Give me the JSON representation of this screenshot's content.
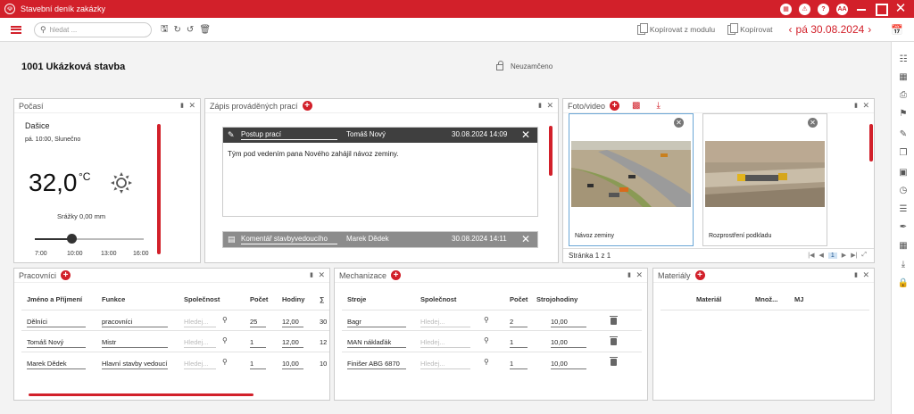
{
  "app": {
    "title": "Stavební deník zakázky",
    "logo_letter": "☫",
    "user_initials": "AA",
    "help_glyph": "?"
  },
  "toolbar": {
    "search_placeholder": "hledat ...",
    "copy_module_label": "Kopírovat z modulu",
    "copy_label": "Kopírovat",
    "date_label": "pá 30.08.2024"
  },
  "project": {
    "title": "1001  Ukázková stavba",
    "lock_status": "Neuzamčeno"
  },
  "weather": {
    "header": "Počasí",
    "location": "Dašice",
    "subtitle": "pá. 10:00, Slunečno",
    "temperature": "32,0",
    "unit": "°C",
    "rain": "Srážky 0,00 mm",
    "slider_value": 0.34,
    "ticks": [
      "7:00",
      "10:00",
      "13:00",
      "16:00"
    ]
  },
  "worklog": {
    "header": "Zápis prováděných prací",
    "entries": [
      {
        "title": "Postup prací",
        "author": "Tomáš Nový",
        "datetime": "30.08.2024 14:09",
        "text_prefix": "Tým pod vedením pana Nového zahájil",
        "text_emph": "návoz zeminy."
      },
      {
        "title": "Komentář stavbyvedoucího",
        "author": "Marek Dědek",
        "datetime": "30.08.2024 14:11"
      }
    ]
  },
  "photos": {
    "header": "Foto/video",
    "items": [
      {
        "caption": "Návoz zeminy"
      },
      {
        "caption": "Rozprostření podkladu"
      }
    ],
    "pager_text": "Stránka 1 z 1",
    "current_page": "1"
  },
  "workers": {
    "header": "Pracovníci",
    "columns": [
      "Jméno a Příjmení",
      "Funkce",
      "Společnost",
      "Počet",
      "Hodiny",
      "∑"
    ],
    "search_placeholder": "Hledej...",
    "rows": [
      {
        "name": "Dělníci",
        "role": "pracovníci",
        "count": "25",
        "hours": "12,00",
        "sum": "30"
      },
      {
        "name": "Tomáš Nový",
        "role": "Mistr",
        "count": "1",
        "hours": "12,00",
        "sum": "12"
      },
      {
        "name": "Marek Dědek",
        "role": "Hlavní stavby vedoucí",
        "count": "1",
        "hours": "10,00",
        "sum": "10"
      }
    ],
    "scroll_fraction": 0.74
  },
  "machines": {
    "header": "Mechanizace",
    "columns": [
      "Stroje",
      "Společnost",
      "Počet",
      "Strojohodiny"
    ],
    "search_placeholder": "Hledej...",
    "rows": [
      {
        "name": "Bagr",
        "count": "2",
        "hours": "10,00"
      },
      {
        "name": "MAN náklaďák",
        "count": "1",
        "hours": "10,00"
      },
      {
        "name": "Finišer ABG 6870",
        "count": "1",
        "hours": "10,00"
      }
    ]
  },
  "materials": {
    "header": "Materiály",
    "columns": [
      "Materiál",
      "Množ...",
      "MJ"
    ]
  },
  "colors": {
    "accent": "#d2202a",
    "dark_header": "#3f3f3f",
    "grey_header": "#8c8c8c"
  }
}
